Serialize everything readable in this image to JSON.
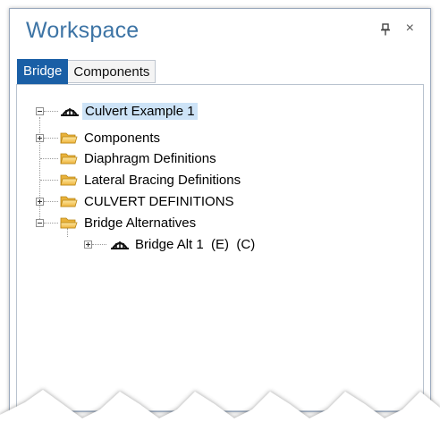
{
  "panel": {
    "title": "Workspace",
    "pin_icon": "pin-icon",
    "close_symbol": "×"
  },
  "tabs": [
    {
      "label": "Bridge",
      "active": true
    },
    {
      "label": "Components",
      "active": false
    }
  ],
  "tree": {
    "root": {
      "label": "Culvert Example 1",
      "icon": "bridge-icon",
      "expanded": true
    },
    "children": [
      {
        "label": "Components",
        "icon": "folder-icon",
        "expander": "plus"
      },
      {
        "label": "Diaphragm Definitions",
        "icon": "folder-icon",
        "expander": "none"
      },
      {
        "label": "Lateral Bracing Definitions",
        "icon": "folder-icon",
        "expander": "none"
      },
      {
        "label": "CULVERT DEFINITIONS",
        "icon": "folder-icon",
        "expander": "plus"
      },
      {
        "label": "Bridge Alternatives",
        "icon": "folder-open-icon",
        "expander": "minus"
      }
    ],
    "alternatives": [
      {
        "label": "Bridge Alt 1  (E)  (C)",
        "icon": "bridge-icon",
        "expander": "plus"
      }
    ]
  },
  "colors": {
    "title": "#3d74a5",
    "tab_active_bg": "#1a5fa6",
    "selection_bg": "#cde3f7",
    "folder": "#f2c14e"
  }
}
